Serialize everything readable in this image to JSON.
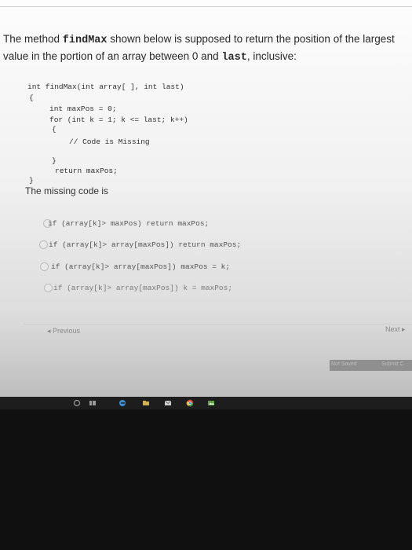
{
  "question": {
    "line1_a": "The method ",
    "line1_method": "findMax",
    "line1_b": " shown below is supposed to return the position of the largest",
    "line2_a": "value in the portion of an array between 0 and ",
    "line2_var": "last",
    "line2_b": ", inclusive:"
  },
  "code": {
    "signature": "int findMax(int array[ ], int last)",
    "open_brace": "{",
    "line_maxpos": "int maxPos = 0;",
    "line_for": "for (int k = 1; k <= last; k++)",
    "for_open": "{",
    "comment": "// Code is Missing",
    "for_close": "}",
    "return_line": "return maxPos;",
    "close_brace": "}"
  },
  "missing_label": "The missing code is",
  "options": [
    "if (array[k]> maxPos) return maxPos;",
    "if (array[k]> array[maxPos]) return maxPos;",
    "if (array[k]> array[maxPos]) maxPos = k;",
    "if (array[k]> array[maxPos]) k = maxPos;"
  ],
  "nav": {
    "previous": "◂ Previous",
    "next": "Next ▸",
    "save": "Not Saved",
    "submit": "Submit C"
  },
  "taskbar_icons": [
    "ask-icon",
    "taskview-icon",
    "edge-icon",
    "explorer-icon",
    "mail-icon",
    "chrome-icon",
    "photos-icon"
  ],
  "colors": {
    "edge": "#3b8fd8",
    "chrome_red": "#d9472f",
    "photos": "#5fa343"
  }
}
